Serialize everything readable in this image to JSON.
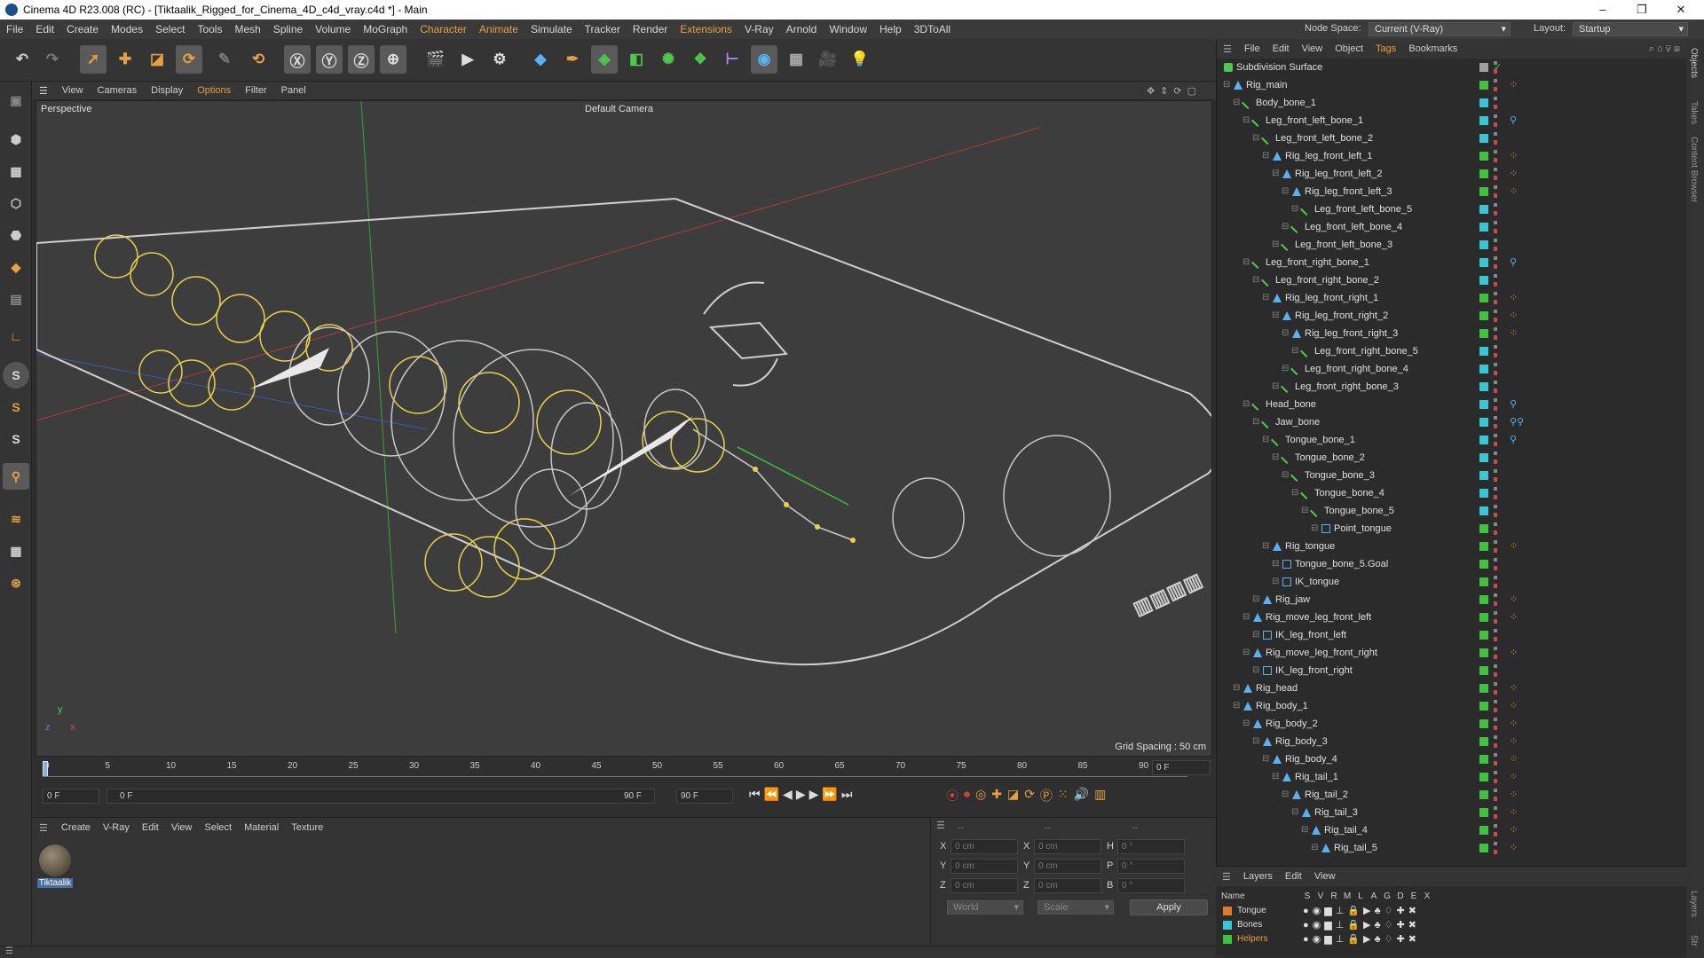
{
  "window": {
    "title": "Cinema 4D R23.008 (RC) - [Tiktaalik_Rigged_for_Cinema_4D_c4d_vray.c4d *] - Main",
    "minimize": "–",
    "maximize": "❐",
    "close": "✕"
  },
  "menubar": {
    "items": [
      "File",
      "Edit",
      "Create",
      "Modes",
      "Select",
      "Tools",
      "Mesh",
      "Spline",
      "Volume",
      "MoGraph",
      "Character",
      "Animate",
      "Simulate",
      "Tracker",
      "Render",
      "Extensions",
      "V-Ray",
      "Arnold",
      "Window",
      "Help",
      "3DToAll"
    ],
    "node_space_label": "Node Space:",
    "node_space_value": "Current (V-Ray)",
    "layout_label": "Layout:",
    "layout_value": "Startup"
  },
  "viewport": {
    "menu": [
      "View",
      "Cameras",
      "Display",
      "Options",
      "Filter",
      "Panel"
    ],
    "name": "Perspective",
    "camera": "Default Camera",
    "grid_spacing": "Grid Spacing : 50 cm",
    "axis_x": "x",
    "axis_y": "y",
    "axis_z": "z"
  },
  "timeline": {
    "ticks": [
      "0",
      "5",
      "10",
      "15",
      "20",
      "25",
      "30",
      "35",
      "40",
      "45",
      "50",
      "55",
      "60",
      "65",
      "70",
      "75",
      "80",
      "85",
      "90"
    ],
    "current_frame": "0 F",
    "start_frame": "0 F",
    "slider_start": "0 F",
    "slider_end": "90 F",
    "end_frame": "90 F",
    "right_frame": "0 F"
  },
  "material_manager": {
    "menu": [
      "Create",
      "V-Ray",
      "Edit",
      "View",
      "Select",
      "Material",
      "Texture"
    ],
    "materials": [
      {
        "name": "Tiktaalik"
      }
    ]
  },
  "coordinates": {
    "header": "--",
    "header2": "--",
    "header3": "--",
    "rows": [
      {
        "a": "X",
        "av": "0 cm",
        "b": "X",
        "bv": "0 cm",
        "c": "H",
        "cv": "0 °"
      },
      {
        "a": "Y",
        "av": "0 cm",
        "b": "Y",
        "bv": "0 cm",
        "c": "P",
        "cv": "0 °"
      },
      {
        "a": "Z",
        "av": "0 cm",
        "b": "Z",
        "bv": "0 cm",
        "c": "B",
        "cv": "0 °"
      }
    ],
    "mode": "World",
    "scale": "Scale",
    "apply": "Apply"
  },
  "object_manager": {
    "menu": [
      "File",
      "Edit",
      "View",
      "Object",
      "Tags",
      "Bookmarks"
    ],
    "objects": [
      {
        "name": "Subdivision Surface",
        "depth": 0,
        "icon": "subdiv",
        "color": "#a0a0a0",
        "tag": "check"
      },
      {
        "name": "Rig_main",
        "depth": 1,
        "icon": "null",
        "color": "#3fc23f",
        "tag": "dots"
      },
      {
        "name": "Body_bone_1",
        "depth": 2,
        "icon": "bone",
        "color": "#39c6d6",
        "tag": ""
      },
      {
        "name": "Leg_front_left_bone_1",
        "depth": 3,
        "icon": "bone",
        "color": "#39c6d6",
        "tag": "ik"
      },
      {
        "name": "Leg_front_left_bone_2",
        "depth": 4,
        "icon": "bone",
        "color": "#39c6d6",
        "tag": ""
      },
      {
        "name": "Rig_leg_front_left_1",
        "depth": 5,
        "icon": "null",
        "color": "#3fc23f",
        "tag": "dots"
      },
      {
        "name": "Rig_leg_front_left_2",
        "depth": 6,
        "icon": "null",
        "color": "#3fc23f",
        "tag": "dots"
      },
      {
        "name": "Rig_leg_front_left_3",
        "depth": 7,
        "icon": "null",
        "color": "#3fc23f",
        "tag": "dots"
      },
      {
        "name": "Leg_front_left_bone_5",
        "depth": 8,
        "icon": "bone",
        "color": "#39c6d6",
        "tag": ""
      },
      {
        "name": "Leg_front_left_bone_4",
        "depth": 7,
        "icon": "bone",
        "color": "#39c6d6",
        "tag": ""
      },
      {
        "name": "Leg_front_left_bone_3",
        "depth": 6,
        "icon": "bone",
        "color": "#39c6d6",
        "tag": ""
      },
      {
        "name": "Leg_front_right_bone_1",
        "depth": 3,
        "icon": "bone",
        "color": "#39c6d6",
        "tag": "ik"
      },
      {
        "name": "Leg_front_right_bone_2",
        "depth": 4,
        "icon": "bone",
        "color": "#39c6d6",
        "tag": ""
      },
      {
        "name": "Rig_leg_front_right_1",
        "depth": 5,
        "icon": "null",
        "color": "#3fc23f",
        "tag": "dots"
      },
      {
        "name": "Rig_leg_front_right_2",
        "depth": 6,
        "icon": "null",
        "color": "#3fc23f",
        "tag": "dots"
      },
      {
        "name": "Rig_leg_front_right_3",
        "depth": 7,
        "icon": "null",
        "color": "#3fc23f",
        "tag": "dots"
      },
      {
        "name": "Leg_front_right_bone_5",
        "depth": 8,
        "icon": "bone",
        "color": "#39c6d6",
        "tag": ""
      },
      {
        "name": "Leg_front_right_bone_4",
        "depth": 7,
        "icon": "bone",
        "color": "#39c6d6",
        "tag": ""
      },
      {
        "name": "Leg_front_right_bone_3",
        "depth": 6,
        "icon": "bone",
        "color": "#39c6d6",
        "tag": ""
      },
      {
        "name": "Head_bone",
        "depth": 3,
        "icon": "bone",
        "color": "#39c6d6",
        "tag": "ik"
      },
      {
        "name": "Jaw_bone",
        "depth": 4,
        "icon": "bone",
        "color": "#39c6d6",
        "tag": "ik2"
      },
      {
        "name": "Tongue_bone_1",
        "depth": 5,
        "icon": "bone",
        "color": "#39c6d6",
        "tag": "ik"
      },
      {
        "name": "Tongue_bone_2",
        "depth": 6,
        "icon": "bone",
        "color": "#39c6d6",
        "tag": ""
      },
      {
        "name": "Tongue_bone_3",
        "depth": 7,
        "icon": "bone",
        "color": "#39c6d6",
        "tag": ""
      },
      {
        "name": "Tongue_bone_4",
        "depth": 8,
        "icon": "bone",
        "color": "#39c6d6",
        "tag": ""
      },
      {
        "name": "Tongue_bone_5",
        "depth": 9,
        "icon": "bone",
        "color": "#39c6d6",
        "tag": ""
      },
      {
        "name": "Point_tongue",
        "depth": 10,
        "icon": "point",
        "color": "#3fc23f",
        "tag": ""
      },
      {
        "name": "Rig_tongue",
        "depth": 5,
        "icon": "null",
        "color": "#3fc23f",
        "tag": "dots"
      },
      {
        "name": "Tongue_bone_5.Goal",
        "depth": 6,
        "icon": "point",
        "color": "#3fc23f",
        "tag": ""
      },
      {
        "name": "IK_tongue",
        "depth": 6,
        "icon": "point",
        "color": "#3fc23f",
        "tag": ""
      },
      {
        "name": "Rig_jaw",
        "depth": 4,
        "icon": "null",
        "color": "#3fc23f",
        "tag": "dots"
      },
      {
        "name": "Rig_move_leg_front_left",
        "depth": 3,
        "icon": "null",
        "color": "#3fc23f",
        "tag": "dots"
      },
      {
        "name": "IK_leg_front_left",
        "depth": 4,
        "icon": "point",
        "color": "#3fc23f",
        "tag": ""
      },
      {
        "name": "Rig_move_leg_front_right",
        "depth": 3,
        "icon": "null",
        "color": "#3fc23f",
        "tag": "dots"
      },
      {
        "name": "IK_leg_front_right",
        "depth": 4,
        "icon": "point",
        "color": "#3fc23f",
        "tag": ""
      },
      {
        "name": "Rig_head",
        "depth": 2,
        "icon": "null",
        "color": "#3fc23f",
        "tag": "dots"
      },
      {
        "name": "Rig_body_1",
        "depth": 2,
        "icon": "null",
        "color": "#3fc23f",
        "tag": "dots"
      },
      {
        "name": "Rig_body_2",
        "depth": 3,
        "icon": "null",
        "color": "#3fc23f",
        "tag": "dots"
      },
      {
        "name": "Rig_body_3",
        "depth": 4,
        "icon": "null",
        "color": "#3fc23f",
        "tag": "dots"
      },
      {
        "name": "Rig_body_4",
        "depth": 5,
        "icon": "null",
        "color": "#3fc23f",
        "tag": "dots"
      },
      {
        "name": "Rig_tail_1",
        "depth": 6,
        "icon": "null",
        "color": "#3fc23f",
        "tag": "dots"
      },
      {
        "name": "Rig_tail_2",
        "depth": 7,
        "icon": "null",
        "color": "#3fc23f",
        "tag": "dots"
      },
      {
        "name": "Rig_tail_3",
        "depth": 8,
        "icon": "null",
        "color": "#3fc23f",
        "tag": "dots"
      },
      {
        "name": "Rig_tail_4",
        "depth": 9,
        "icon": "null",
        "color": "#3fc23f",
        "tag": "dots"
      },
      {
        "name": "Rig_tail_5",
        "depth": 10,
        "icon": "null",
        "color": "#3fc23f",
        "tag": "dots"
      }
    ]
  },
  "layers": {
    "menu": [
      "Layers",
      "Edit",
      "View"
    ],
    "header_name": "Name",
    "columns": [
      "S",
      "V",
      "R",
      "M",
      "L",
      "A",
      "G",
      "D",
      "E",
      "X"
    ],
    "items": [
      {
        "name": "Tongue",
        "color": "#e07a2a",
        "highlight": false
      },
      {
        "name": "Bones",
        "color": "#39c6d6",
        "highlight": false
      },
      {
        "name": "Helpers",
        "color": "#3fc23f",
        "highlight": true
      }
    ]
  },
  "right_tabs": [
    "Objects",
    "Takes",
    "Content Browser",
    "Layers",
    "Str"
  ],
  "colors": {
    "accent": "#e8a040",
    "bone": "#39c6d6",
    "null": "#3fc23f",
    "tongue": "#e07a2a"
  }
}
